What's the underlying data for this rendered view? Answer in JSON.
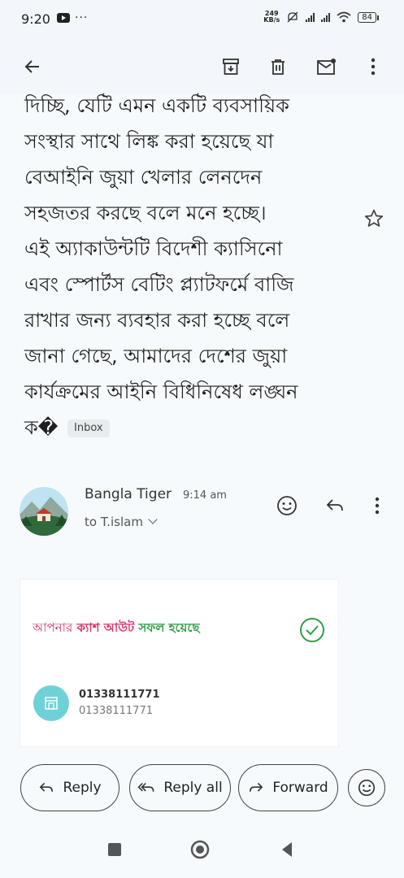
{
  "status_bar": {
    "time": "9:20",
    "more": "···",
    "net_speed_value": "249",
    "net_speed_unit": "KB/s",
    "battery": "84"
  },
  "toolbar": {
    "icons": [
      "back-arrow-icon",
      "archive-icon",
      "delete-icon",
      "mark-unread-icon",
      "more-vert-icon"
    ]
  },
  "email": {
    "body_lines": [
      "দিচ্ছি, যেটি এমন একটি ব্যবসায়িক",
      "সংস্থার সাথে লিঙ্ক করা হয়েছে যা",
      "বেআইনি জুয়া খেলার লেনদেন",
      "সহজতর করছে বলে মনে হচ্ছে।",
      "এই অ্যাকাউন্টটি বিদেশী ক্যাসিনো",
      "এবং স্পোর্টস বেটিং প্ল্যাটফর্মে বাজি",
      "রাখার জন্য ব্যবহার করা হচ্ছে বলে",
      "জানা গেছে, আমাদের দেশের জুয়া",
      "কার্যক্রমের আইনি বিধিনিষেধ লঙ্ঘন"
    ],
    "last_line": "ক�",
    "label": "Inbox"
  },
  "sender": {
    "name": "Bangla Tiger",
    "time": "9:14 am",
    "to": "to T.islam"
  },
  "card": {
    "title_part1": "আপনার",
    "title_part2": "ক্যাশ আউট",
    "title_part3": "সফল হয়েছে",
    "number_primary": "01338111771",
    "number_secondary": "01338111771",
    "colors": {
      "pink": "#d6336c",
      "green": "#2f9e44",
      "teal": "#6fd1d8"
    }
  },
  "actions": {
    "reply": "Reply",
    "reply_all": "Reply all",
    "forward": "Forward"
  }
}
